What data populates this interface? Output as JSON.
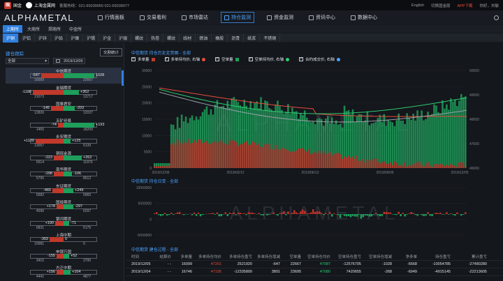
{
  "topbar": {
    "logo_text": "国金",
    "logo_sub": "GUOJIN",
    "partner": "上海金属网",
    "hotline": "客服热线：021-65039055 021-65039077",
    "lang": "English",
    "switch_site": "切换国金版",
    "app_download": "APP下载",
    "user": "你好，刘敏"
  },
  "nav": {
    "brand": "ALPHAMETAL",
    "items": [
      {
        "label": "行情面板"
      },
      {
        "label": "交易看利"
      },
      {
        "label": "市场雷达"
      },
      {
        "label": "持仓监测"
      },
      {
        "label": "资金监测"
      },
      {
        "label": "资讯中心"
      },
      {
        "label": "数据中心"
      }
    ],
    "active_index": 3
  },
  "exchanges": [
    "上期所",
    "大商所",
    "郑商所",
    "中金所"
  ],
  "exchange_active": 0,
  "products": [
    "沪铜",
    "沪铝",
    "沪锌",
    "沪铅",
    "沪镍",
    "沪锡",
    "沪金",
    "沪银",
    "螺纹",
    "热卷",
    "螺纹",
    "线材",
    "燃油",
    "橡胶",
    "沥青",
    "纸浆",
    "不锈钢"
  ],
  "product_active": 0,
  "left": {
    "title": "建仓跟踪",
    "stats_button": "交割统计",
    "filter": "全部",
    "date": "2019/12/05",
    "brokers": [
      {
        "name": "中信期货",
        "l": "-647",
        "r": "1028",
        "l2": "16099",
        "r2": "22667",
        "lw": 32,
        "rw": 44,
        "selected": true
      },
      {
        "name": "金瑞期货",
        "l": "-1186",
        "r": "+362",
        "l2": "21073",
        "r2": "13717",
        "lw": 44,
        "rw": 22
      },
      {
        "name": "国泰君安",
        "l": "-145",
        "r": "-203",
        "l2": "12826",
        "r2": "12037",
        "lw": 18,
        "rw": 16
      },
      {
        "name": "五矿经易",
        "l": "-74",
        "r": "+193",
        "l2": "1455",
        "r2": "18209",
        "lw": 8,
        "rw": 44
      },
      {
        "name": "永安期货",
        "l": "+1139",
        "r": "+125",
        "l2": "13057",
        "r2": "5139",
        "lw": 40,
        "rw": 10
      },
      {
        "name": "铜冠金源",
        "l": "-223",
        "r": "+262",
        "l2": "5614",
        "r2": "11870",
        "lw": 14,
        "rw": 26
      },
      {
        "name": "南华期货",
        "l": "-298",
        "r": "-106",
        "l2": "5795",
        "r2": "8512",
        "lw": 14,
        "rw": 12
      },
      {
        "name": "东证期货",
        "l": "-465",
        "r": "+249",
        "l2": "6582",
        "r2": "5965",
        "lw": 16,
        "rw": 14
      },
      {
        "name": "国投期货",
        "l": "+178",
        "r": "-297",
        "l2": "4096",
        "r2": "6297",
        "lw": 10,
        "rw": 14
      },
      {
        "name": "银河期货",
        "l": "+190",
        "r": "-71",
        "l2": "6831",
        "r2": "5175",
        "lw": 12,
        "rw": 8
      },
      {
        "name": "上海中期",
        "l": "-303",
        "r": "0",
        "l2": "10081",
        "r2": "0",
        "lw": 20,
        "rw": 0
      },
      {
        "name": "申银万国",
        "l": "-155",
        "r": "+52",
        "l2": "3415",
        "r2": "3795",
        "lw": 10,
        "rw": 8
      },
      {
        "name": "方正中期",
        "l": "+156",
        "r": "+164",
        "l2": "4441",
        "r2": "4877",
        "lw": 10,
        "rw": 10
      }
    ]
  },
  "chart1": {
    "title": "中信期货 持仓历史走势图 - 全部",
    "legend": [
      "多单量",
      "多单持均价, 右轴",
      "空单量",
      "空单持均价, 右轴",
      "合约成交价, 右轴"
    ],
    "watermark": "ALPHAMETAL",
    "yleft": [
      "30000",
      "25000",
      "20000",
      "15000",
      "10000",
      "5000",
      "0"
    ],
    "yright": [
      "50000",
      "49000",
      "48000",
      "47000",
      "46000"
    ],
    "xticks": [
      "2019/12/06",
      "2019/03/12",
      "2019/06/12",
      "2019/09/05",
      "2019/12/05"
    ]
  },
  "chart2": {
    "title": "中信期货 持仓日变 - 全部",
    "yleft": [
      "10000000",
      "5000000",
      "0",
      "-5000000"
    ],
    "xticks": [
      "2019/12/06",
      "2019/03/12",
      "2019/06/12",
      "2019/09/05",
      "2019/12/05"
    ]
  },
  "table": {
    "title": "中信期货 建仓过程 - 全部",
    "headers": [
      "时间",
      "结算价",
      "多单量",
      "多单持仓均价",
      "多单持仓盈亏",
      "多单持仓增减",
      "空单量",
      "空单持仓均价",
      "空单持仓盈亏",
      "空单持仓增减",
      "净多单",
      "持仓盈亏",
      "累计盈亏"
    ],
    "rows": [
      [
        "2019/12/05",
        "- -",
        "16099",
        "47201",
        "2521920",
        "-647",
        "22667",
        "47087",
        "-12576705",
        "-1028",
        "-6568",
        "-10054785",
        "-27480280"
      ],
      [
        "2019/12/04",
        "- -",
        "16746",
        "47195",
        "-12335800",
        "3801",
        "23695",
        "47080",
        "7420655",
        "-268",
        "-6949",
        "-4915145",
        "-22213605"
      ]
    ]
  },
  "colors": {
    "accent": "#2f7fe0",
    "red": "#e74c3c",
    "green": "#1e9e5a"
  }
}
